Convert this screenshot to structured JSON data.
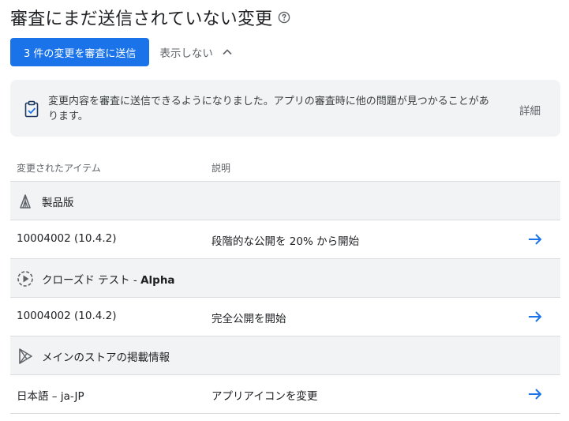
{
  "header": {
    "title": "審査にまだ送信されていない変更",
    "help_icon": "help-circle-icon"
  },
  "actions": {
    "send_button_label": "3 件の変更を審査に送信",
    "hide_label": "表示しない",
    "hide_icon": "chevron-up-icon"
  },
  "banner": {
    "icon": "clipboard-check-icon",
    "message": "変更内容を審査に送信できるようになりました。アプリの審査時に他の問題が見つかることがあります。",
    "details_label": "詳細"
  },
  "table": {
    "columns": [
      "変更されたアイテム",
      "説明"
    ],
    "groups": [
      {
        "icon": "production-track-icon",
        "title": "製品版",
        "title_suffix": "",
        "rows": [
          {
            "item": "10004002 (10.4.2)",
            "description": "段階的な公開を 20% から開始",
            "action_icon": "arrow-right-icon"
          }
        ]
      },
      {
        "icon": "closed-testing-icon",
        "title": "クローズド テスト - ",
        "title_suffix": "Alpha",
        "rows": [
          {
            "item": "10004002 (10.4.2)",
            "description": "完全公開を開始",
            "action_icon": "arrow-right-icon"
          }
        ]
      },
      {
        "icon": "play-store-icon",
        "title": "メインのストアの掲載情報",
        "title_suffix": "",
        "rows": [
          {
            "item": "日本語 – ja-JP",
            "description": "アプリアイコンを変更",
            "action_icon": "arrow-right-icon"
          }
        ]
      }
    ]
  },
  "colors": {
    "primary": "#1a73e8",
    "banner_bg": "#f1f3f4",
    "group_bg": "#f1f3f4",
    "muted_text": "#5f6368",
    "divider": "#dadce0"
  }
}
